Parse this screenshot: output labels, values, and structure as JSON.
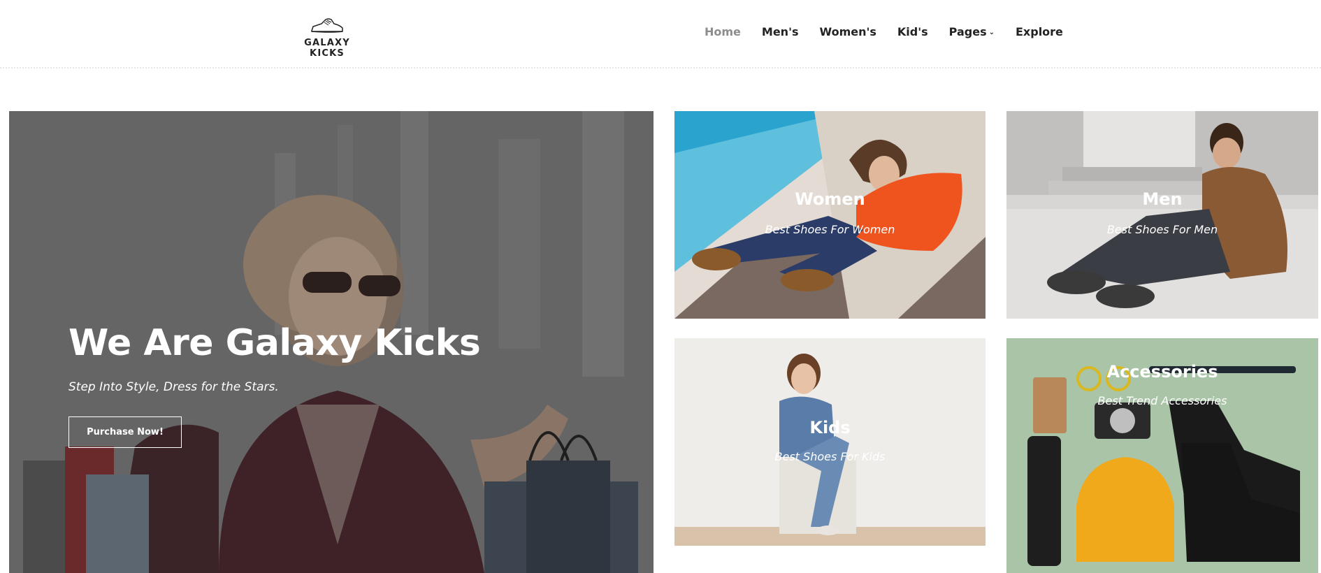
{
  "logo": {
    "text": "GALAXY KICKS",
    "icon": "sneaker-icon"
  },
  "nav": {
    "items": [
      {
        "label": "Home",
        "active": true
      },
      {
        "label": "Men's",
        "active": false
      },
      {
        "label": "Women's",
        "active": false
      },
      {
        "label": "Kid's",
        "active": false
      },
      {
        "label": "Pages",
        "active": false,
        "has_dropdown": true
      },
      {
        "label": "Explore",
        "active": false
      }
    ],
    "dropdown_icon": "chevron-down-icon"
  },
  "hero": {
    "title": "We Are Galaxy Kicks",
    "subtitle": "Step Into Style, Dress for the Stars.",
    "button_label": "Purchase Now!"
  },
  "categories": [
    {
      "title": "Women",
      "subtitle": "Best Shoes For Women"
    },
    {
      "title": "Men",
      "subtitle": "Best Shoes For Men"
    },
    {
      "title": "Kids",
      "subtitle": "Best Shoes For Kids"
    },
    {
      "title": "Accessories",
      "subtitle": "Best Trend Accessories"
    }
  ],
  "colors": {
    "text_dark": "#222222",
    "nav_active": "#8c8c8c",
    "white": "#ffffff"
  }
}
